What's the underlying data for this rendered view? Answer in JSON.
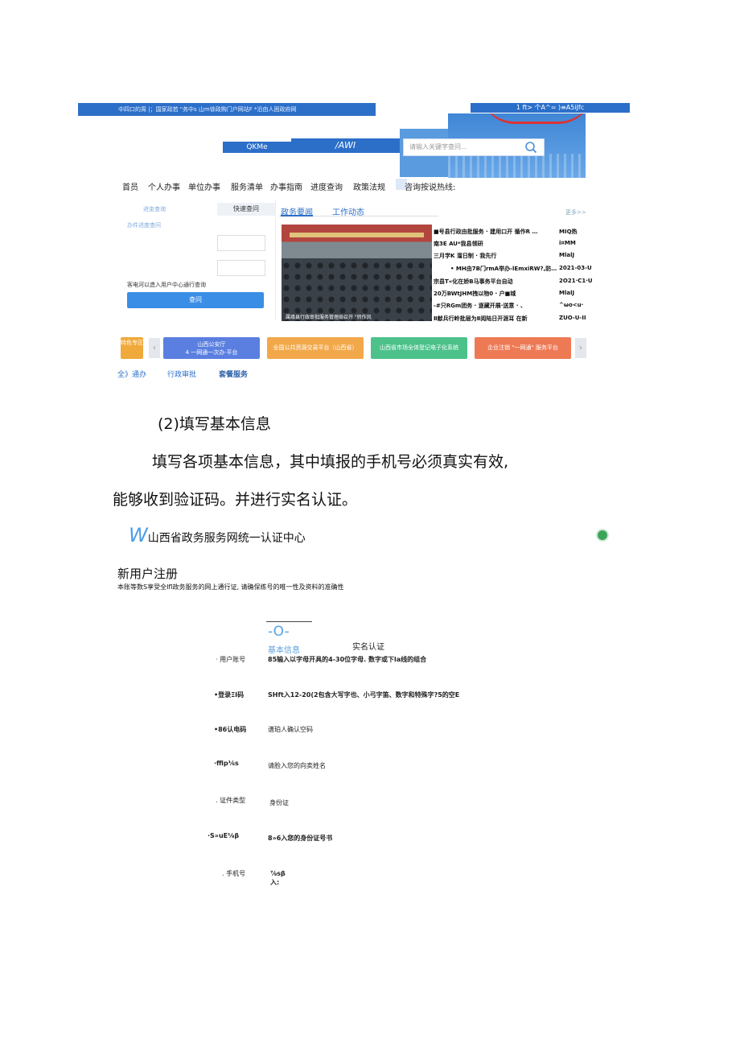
{
  "portal": {
    "topbar_left": "中四口的周 |；国家政若 \"务中s 山m徐政购门户网站F *沿由人困政府网",
    "topbar_right": "1 ft> 个A^= )≡A5iJfc",
    "logo_a": "QKMe",
    "logo_b": "/AWI",
    "search_placeholder": "请输入关键字查问…",
    "nav": [
      "首员",
      "个人办事",
      "单位办事",
      "服务清单",
      "办事指南",
      "进度查询",
      "政策法规",
      "咨询按说热线:"
    ],
    "left_links": [
      "进金查询",
      "办件进度查问"
    ],
    "quick_tab": "快速查问",
    "left_hint": "客电河以造入用户中心通行查询",
    "left_button": "查问",
    "news_tabs": [
      "政务要闻",
      "工作动态"
    ],
    "more": "更多>>",
    "photo_caption": "属缘县行政审批服务管理局召开 \"转作风",
    "news": [
      {
        "title": "■号县行政由批服务 · 建用口开 循作R …",
        "date": "MIQ热"
      },
      {
        "title": "南3E AU*我县领研",
        "date": "i¤MM"
      },
      {
        "title": "三月学K 溜日制 · 我先行",
        "date": "MlalJ"
      },
      {
        "title": "• MH由7B门rmA举办-lEmxiRW?,防…",
        "date": "2021-03-U"
      },
      {
        "title": "宗县T«化在娇B马事务平台自动",
        "date": "2O21·C1·U"
      },
      {
        "title": "20万BWtJHM拽以物0 · 户■城",
        "date": "MlalJ"
      },
      {
        "title": "-#只RGm团务 · 逐藏开展·送意 · 、",
        "date": "^ωo<u·"
      },
      {
        "title": "Ⅱ献兵行岭批层为Ⅱ阅陆日开涯耳 在新",
        "date": "ZUO-U-II"
      }
    ],
    "tiles": [
      {
        "label": "特色专区",
        "color": "#f0a93b"
      },
      {
        "label": "山西公安厅\n4 一网通一次办·平台",
        "color": "#5b7fe0"
      },
      {
        "label": "全国公共资源交易平台（山西省）",
        "color": "#f2a84a"
      },
      {
        "label": "山西省市场全体登记电子化系统",
        "color": "#4cc28a"
      },
      {
        "label": "企业注销 \"一网通\" 服务平台",
        "color": "#ee7a55"
      }
    ],
    "services": [
      "全》通办",
      "行政审批",
      "套餐服务"
    ]
  },
  "doc": {
    "heading": "(2)填写基本信息",
    "para_line1": "填写各项基本信息，其中填报的手机号必须真实有效,",
    "para_line2": "能够收到验证码。并进行实名认证。"
  },
  "register": {
    "brand_w": "W",
    "brand_text": "山西省政务服务网统一认证中心",
    "title": "新用户注册",
    "desc": "本账等数S享受全Ifl政务服务的网上通行证, 请确保练号的唯一性及资料的准确性",
    "step_mark": "-O-",
    "step1": "基本信息",
    "step2": "实名认证",
    "fields": [
      {
        "label": "· 用户账号",
        "value": "85输入以字母开具的4-30位字母. 数字或下la线的组合"
      },
      {
        "label": "•登录ΞI码",
        "value": "SHft入12-20(2包含大写字也、小弓字笛、数字和特殊字?5的空E"
      },
      {
        "label": "•86认电码",
        "value": "谱珀人确认空码"
      },
      {
        "label": "·ffip⅙s",
        "value": "请脸入您的向卖姓名"
      },
      {
        "label": ". 证件类型",
        "value": "身份证"
      },
      {
        "label": "·S»uE⅛β",
        "value": "8»6入您的身份证号书"
      },
      {
        "label": ". 手机号",
        "value": "⅞sβ\n入:"
      }
    ]
  }
}
